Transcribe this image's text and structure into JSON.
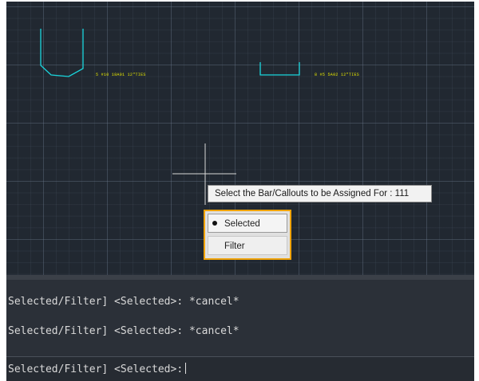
{
  "drawing": {
    "callout_left": "5 #10 18A01 12\"TIES",
    "callout_right": "8 #5 5A02 12\"TIES",
    "colors": {
      "bar_shape": "#19d6dd",
      "callout_text": "#e8e800",
      "crosshair": "#d8d8d8",
      "background": "#212831"
    }
  },
  "tooltip": {
    "text": "Select the Bar/Callouts to be Assigned For : 111"
  },
  "context_menu": {
    "items": [
      {
        "label": "Selected",
        "is_current": true
      },
      {
        "label": "Filter",
        "is_current": false
      }
    ],
    "highlight_color": "#f0a30a"
  },
  "command_line": {
    "history": [
      "Selected/Filter] <Selected>: *cancel*",
      "Selected/Filter] <Selected>: *cancel*"
    ],
    "prompt": "Selected/Filter] <Selected>:"
  }
}
